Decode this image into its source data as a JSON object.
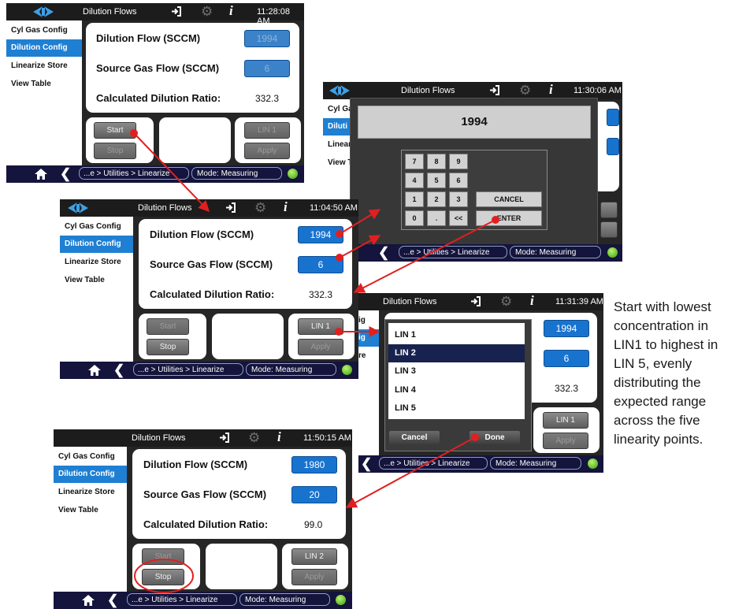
{
  "menu": [
    "Cyl Gas Config",
    "Dilution Config",
    "Linearize Store",
    "View Table"
  ],
  "menu_clipped": {
    "s2": [
      "Cyl Ga",
      "Diluti",
      "Linear",
      "View T"
    ],
    "s4": [
      "ig",
      "ig",
      "re"
    ]
  },
  "fields": {
    "dilution_flow": "Dilution Flow (SCCM)",
    "source_flow": "Source Gas Flow (SCCM)",
    "ratio": "Calculated Dilution Ratio:"
  },
  "buttons": {
    "start": "Start",
    "stop": "Stop",
    "apply": "Apply",
    "cancel_small": "Cancel",
    "done": "Done"
  },
  "footer": {
    "breadcrumb": "...e > Utilities > Linearize",
    "mode": "Mode: Measuring"
  },
  "colors": {
    "accent_blue": "#1f7fd2",
    "arrow_red": "#e02020",
    "status_green": "#5cc21f"
  },
  "s1": {
    "title": "Dilution Flows",
    "time": "11:28:08 AM",
    "dilution": "1994",
    "source": "6",
    "ratio": "332.3",
    "lin": "LIN 1"
  },
  "s2": {
    "title": "Dilution Flows",
    "time": "11:30:06 AM",
    "entry": "1994",
    "keys": [
      "7",
      "8",
      "9",
      "4",
      "5",
      "6",
      "1",
      "2",
      "3",
      "0",
      ".",
      "<<"
    ],
    "cancel": "CANCEL",
    "enter": "ENTER"
  },
  "s3": {
    "title": "Dilution Flows",
    "time": "11:04:50 AM",
    "dilution": "1994",
    "source": "6",
    "ratio": "332.3",
    "lin": "LIN 1"
  },
  "s4": {
    "title": "Dilution Flows",
    "time": "11:31:39 AM",
    "dilution": "1994",
    "source": "6",
    "ratio": "332.3",
    "lin": "LIN 1",
    "list": [
      "LIN 1",
      "LIN 2",
      "LIN 3",
      "LIN 4",
      "LIN 5"
    ],
    "selected": "LIN 2"
  },
  "s5": {
    "title": "Dilution Flows",
    "time": "11:50:15 AM",
    "dilution": "1980",
    "source": "20",
    "ratio": "99.0",
    "lin": "LIN 2"
  },
  "note": "Start with lowest concentration in LIN1 to highest in LIN 5, evenly distributing the expected range across the five linearity points."
}
